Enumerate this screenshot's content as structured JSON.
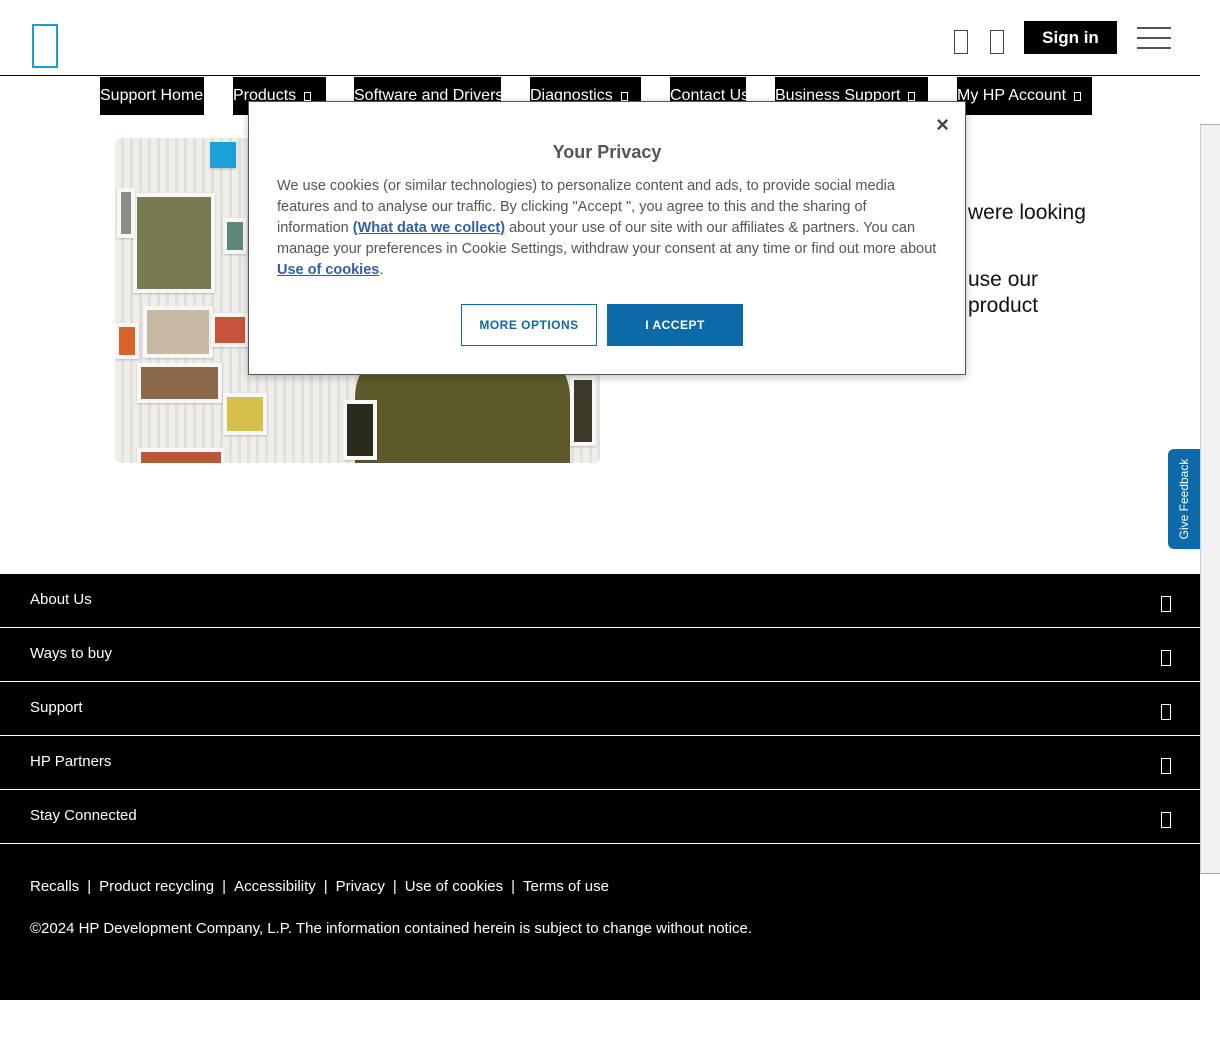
{
  "header": {
    "sign_in_label": "Sign in"
  },
  "nav": {
    "items": [
      {
        "label": "Support Home",
        "has_dropdown": false
      },
      {
        "label": "Products",
        "has_dropdown": true
      },
      {
        "label": "Software and Drivers",
        "has_dropdown": false
      },
      {
        "label": "Diagnostics",
        "has_dropdown": true
      },
      {
        "label": "Contact Us",
        "has_dropdown": false
      },
      {
        "label": "Business Support",
        "has_dropdown": true
      },
      {
        "label": "My HP Account",
        "has_dropdown": true
      }
    ]
  },
  "hero": {
    "text_line1": "were looking",
    "text_line2": "use our",
    "text_line3": "product"
  },
  "privacy_modal": {
    "title": "Your Privacy",
    "close_label": "×",
    "body_part1": "We use cookies (or similar technologies) to personalize content and ads, to provide social media features and to analyse our traffic. By clicking \"Accept \", you agree to this and the sharing of information ",
    "link_what_data": "(What data we collect)",
    "body_part2": " about your use of our site with our affiliates & partners. You can manage your preferences in Cookie Settings, withdraw your consent at any time or find out more about ",
    "link_cookies": "Use of cookies",
    "body_part3": ".",
    "more_options_label": "MORE OPTIONS",
    "accept_label": "I ACCEPT"
  },
  "feedback": {
    "label": "Give Feedback"
  },
  "footer": {
    "sections": [
      "About Us",
      "Ways to buy",
      "Support",
      "HP Partners",
      "Stay Connected"
    ],
    "links": [
      "Recalls",
      "Product recycling",
      "Accessibility",
      "Privacy",
      "Use of cookies",
      "Terms of use"
    ],
    "separator": "|",
    "copyright": "©2024 HP Development Company, L.P. The information contained herein is subject to change without notice."
  },
  "colors": {
    "accent_blue": "#0b6aa7",
    "logo_blue": "#1aa0d0",
    "link_blue": "#2f5fa8"
  }
}
